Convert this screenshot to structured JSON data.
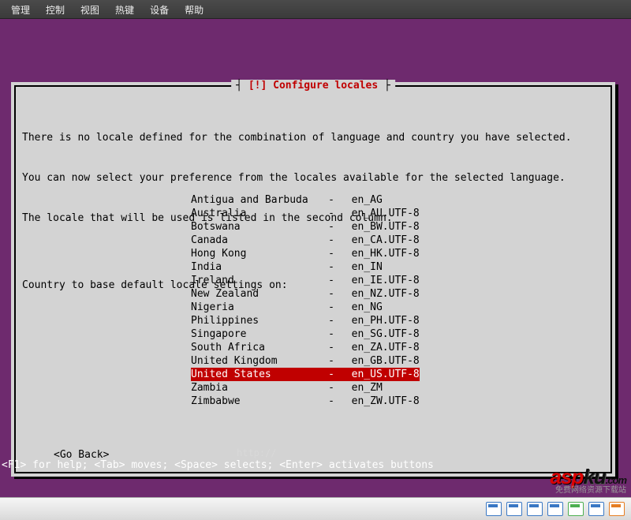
{
  "menubar": [
    "管理",
    "控制",
    "视图",
    "热键",
    "设备",
    "帮助"
  ],
  "dialog": {
    "title": "[!] Configure locales",
    "lines": [
      "There is no locale defined for the combination of language and country you have selected.",
      "You can now select your preference from the locales available for the selected language.",
      "The locale that will be used is listed in the second column.",
      "",
      "Country to base default locale settings on:"
    ],
    "goback": "<Go Back>"
  },
  "locales": [
    {
      "country": "Antigua and Barbuda",
      "locale": "en_AG",
      "selected": false
    },
    {
      "country": "Australia",
      "locale": "en_AU.UTF-8",
      "selected": false
    },
    {
      "country": "Botswana",
      "locale": "en_BW.UTF-8",
      "selected": false
    },
    {
      "country": "Canada",
      "locale": "en_CA.UTF-8",
      "selected": false
    },
    {
      "country": "Hong Kong",
      "locale": "en_HK.UTF-8",
      "selected": false
    },
    {
      "country": "India",
      "locale": "en_IN",
      "selected": false
    },
    {
      "country": "Ireland",
      "locale": "en_IE.UTF-8",
      "selected": false
    },
    {
      "country": "New Zealand",
      "locale": "en_NZ.UTF-8",
      "selected": false
    },
    {
      "country": "Nigeria",
      "locale": "en_NG",
      "selected": false
    },
    {
      "country": "Philippines",
      "locale": "en_PH.UTF-8",
      "selected": false
    },
    {
      "country": "Singapore",
      "locale": "en_SG.UTF-8",
      "selected": false
    },
    {
      "country": "South Africa",
      "locale": "en_ZA.UTF-8",
      "selected": false
    },
    {
      "country": "United Kingdom",
      "locale": "en_GB.UTF-8",
      "selected": false
    },
    {
      "country": "United States",
      "locale": "en_US.UTF-8",
      "selected": true
    },
    {
      "country": "Zambia",
      "locale": "en_ZM",
      "selected": false
    },
    {
      "country": "Zimbabwe",
      "locale": "en_ZW.UTF-8",
      "selected": false
    }
  ],
  "help_line": "<F1> for help; <Tab> moves; <Space> selects; <Enter> activates buttons",
  "watermark": {
    "text1": "asp",
    "text2": "ku",
    "suffix": ".com",
    "cn": "免费网络资源下载站"
  },
  "url_wm": "http://"
}
